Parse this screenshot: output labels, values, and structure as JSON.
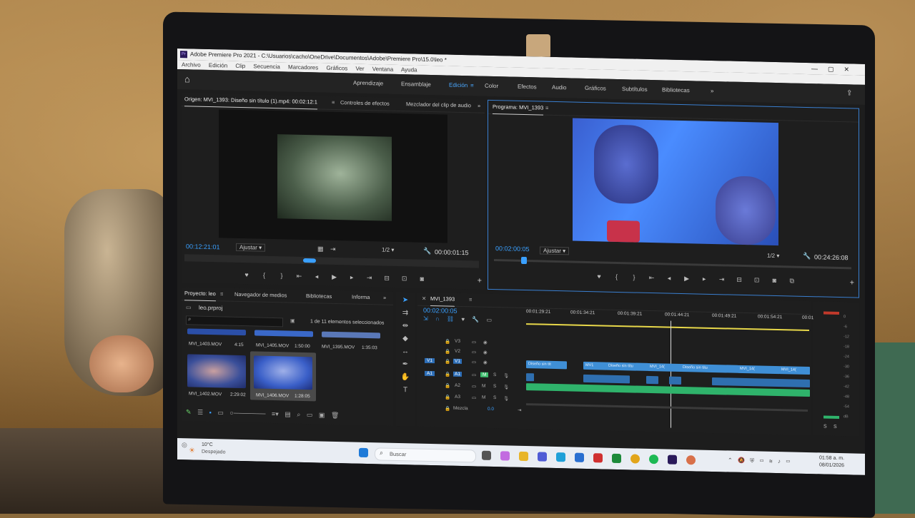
{
  "window": {
    "title": "Adobe Premiere Pro 2021 - C:\\Usuarios\\cacho\\OneDrive\\Documentos\\Adobe\\Premiere Pro\\15.0\\leo *",
    "controls": [
      "—",
      "▢",
      "✕"
    ]
  },
  "menu": [
    "Archivo",
    "Edición",
    "Clip",
    "Secuencia",
    "Marcadores",
    "Gráficos",
    "Ver",
    "Ventana",
    "Ayuda"
  ],
  "workspaces": {
    "items": [
      "Aprendizaje",
      "Ensamblaje",
      "Edición",
      "Color",
      "Efectos",
      "Audio",
      "Gráficos",
      "Subtítulos",
      "Bibliotecas"
    ],
    "active": "Edición",
    "more": "»"
  },
  "source_monitor": {
    "tabs": [
      "Origen: MVI_1393: Diseño sin título (1).mp4: 00:02:12:1",
      "Controles de efectos",
      "Mezclador del clip de audio"
    ],
    "more": "»",
    "timecode_in": "00:12:21:01",
    "fit": "Ajustar",
    "resolution": "1/2",
    "duration": "00:00:01:15"
  },
  "program_monitor": {
    "tab": "Programa: MVI_1393",
    "timecode": "00:02:00:05",
    "fit": "Ajustar",
    "resolution": "1/2",
    "duration": "00:24:26:08"
  },
  "project": {
    "tabs": [
      "Proyecto: leo",
      "Navegador de medios",
      "Bibliotecas",
      "Informa"
    ],
    "more": "»",
    "file": "leo.prproj",
    "selection_info": "1 de 11 elementos seleccionados",
    "items": [
      {
        "name": "MVI_1403.MOV",
        "duration": "4:15"
      },
      {
        "name": "MVI_1405.MOV",
        "duration": "1:50:00"
      },
      {
        "name": "MVI_1395.MOV",
        "duration": "1:35:03"
      },
      {
        "name": "MVI_1402.MOV",
        "duration": "2:29:02"
      },
      {
        "name": "MVI_1406.MOV",
        "duration": "1:28:05"
      }
    ]
  },
  "timeline": {
    "tab": "MVI_1393",
    "timecode": "00:02:00:05",
    "ruler": [
      "00:01:29:21",
      "00:01:34:21",
      "00:01:39:21",
      "00:01:44:21",
      "00:01:49:21",
      "00:01:54:21",
      "00:01"
    ],
    "tracks": [
      {
        "name": "V3",
        "target": ""
      },
      {
        "name": "V2",
        "target": ""
      },
      {
        "name": "V1",
        "target": "V1"
      },
      {
        "name": "A1",
        "target": "A1"
      },
      {
        "name": "A2",
        "target": ""
      },
      {
        "name": "A3",
        "target": ""
      }
    ],
    "mix_label": "Mezcla",
    "mix_value": "0.0",
    "clips_v1": [
      "Diseño sin tít",
      "MV1",
      "Diseño sin títu",
      "MVI_14(",
      "Diseño sin títu",
      "MVI_14(",
      "MVI_14("
    ]
  },
  "meter": {
    "scale": [
      "0",
      "-6",
      "-12",
      "-18",
      "-24",
      "-30",
      "-36",
      "-42",
      "-48",
      "-54",
      "dB"
    ],
    "solo": [
      "S",
      "S"
    ]
  },
  "taskbar": {
    "weather_temp": "10°C",
    "weather_desc": "Despejado",
    "search_placeholder": "Buscar",
    "time": "01:58 a. m.",
    "date": "08/01/2026"
  },
  "colors": {
    "accent": "#3aa0ff",
    "video_clip": "#3f8fd6",
    "audio_clip": "#2fb36b",
    "playhead": "#e8d84a"
  }
}
